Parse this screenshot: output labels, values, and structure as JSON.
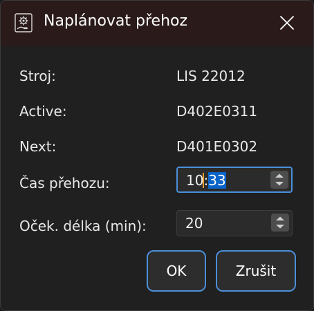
{
  "window": {
    "title": "Naplánovat přehoz",
    "close_icon": "close-icon",
    "app_icon": "gear-hand-icon"
  },
  "fields": {
    "stroj_label": "Stroj:",
    "stroj_value": "LIS 22012",
    "active_label": "Active:",
    "active_value": "D402E0311",
    "next_label": "Next:",
    "next_value": "D401E0302"
  },
  "time_input": {
    "label": "Čas přehozu:",
    "value_hours": "10",
    "value_sep": ":",
    "value_minutes": "33"
  },
  "duration_input": {
    "label": "Oček. délka (min):",
    "value": "20"
  },
  "buttons": {
    "ok_label": "OK",
    "cancel_label": "Zrušit"
  },
  "colors": {
    "titlebar": "#2a1b1a",
    "background": "#202020",
    "accent": "#4a8fd9",
    "selection": "#0a64c8"
  }
}
